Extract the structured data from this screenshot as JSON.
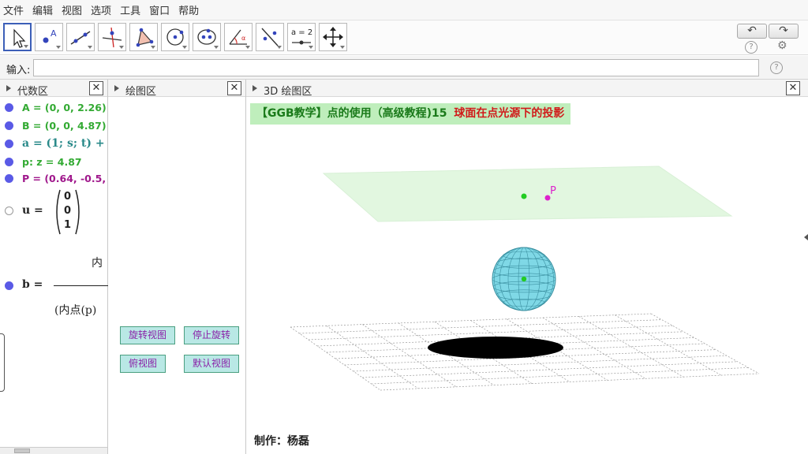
{
  "menu": [
    "文件",
    "编辑",
    "视图",
    "选项",
    "工具",
    "窗口",
    "帮助"
  ],
  "toolbar": {
    "slider_label": "a = 2",
    "undo_icon": "undo-icon",
    "redo_icon": "redo-icon",
    "help_glyph": "?",
    "settings_glyph": "⚙"
  },
  "input": {
    "label": "输入:",
    "value": "",
    "help_glyph": "?"
  },
  "algebra": {
    "title": "代数区",
    "rows": [
      {
        "text": "A = (0, 0, 2.26)",
        "color": "#33aa33"
      },
      {
        "text": "B = (0, 0, 4.87)",
        "color": "#33aa33"
      },
      {
        "text": "a = (1; s; t) +",
        "color": "#2a8a8a"
      },
      {
        "text": "p: z = 4.87",
        "color": "#33aa33"
      },
      {
        "text": "P = (0.64, -0.5, 4",
        "color": "#a0188c"
      }
    ],
    "vector": {
      "label": "u =",
      "values": [
        "0",
        "0",
        "1"
      ]
    },
    "fraction": {
      "label": "b =",
      "numerator": "内",
      "denominator": "(内点(p)"
    }
  },
  "graphics": {
    "title": "绘图区",
    "buttons": [
      "旋转视图",
      "停止旋转",
      "俯视图",
      "默认视图"
    ]
  },
  "graphics3d": {
    "title": "3D 绘图区",
    "banner_part1": "【GGB教学】点的使用（高级教程)15",
    "banner_part2": "球面在点光源下的投影",
    "point_label": "P",
    "credit": "制作：杨磊"
  },
  "colors": {
    "accent": "#3c5fb8",
    "banner_bg": "#bfeebc",
    "banner_green": "#1a7a1a",
    "banner_red": "#d11a1a",
    "sphere": "#7fd8e6",
    "point_green": "#22cc22",
    "point_magenta": "#dd22cc"
  }
}
